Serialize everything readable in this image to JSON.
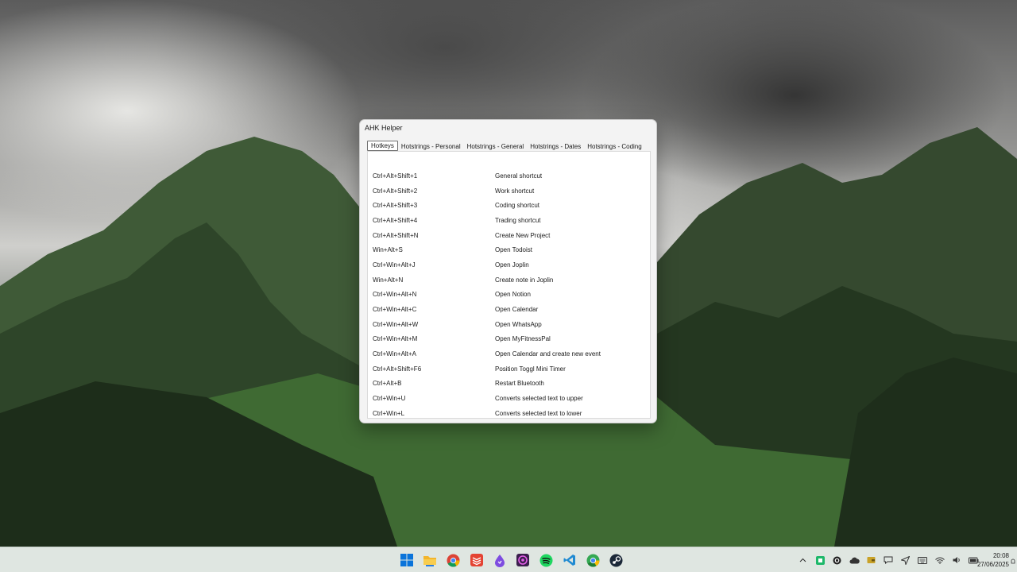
{
  "window": {
    "title": "AHK Helper"
  },
  "tabs": [
    {
      "label": "Hotkeys",
      "active": true
    },
    {
      "label": "Hotstrings - Personal",
      "active": false
    },
    {
      "label": "Hotstrings - General",
      "active": false
    },
    {
      "label": "Hotstrings - Dates",
      "active": false
    },
    {
      "label": "Hotstrings - Coding",
      "active": false
    }
  ],
  "hotkeys": [
    {
      "key": "Ctrl+Alt+Shift+1",
      "desc": "General shortcut"
    },
    {
      "key": "Ctrl+Alt+Shift+2",
      "desc": "Work shortcut"
    },
    {
      "key": "Ctrl+Alt+Shift+3",
      "desc": "Coding shortcut"
    },
    {
      "key": "Ctrl+Alt+Shift+4",
      "desc": "Trading shortcut"
    },
    {
      "key": "Ctrl+Alt+Shift+N",
      "desc": "Create New Project"
    },
    {
      "key": "Win+Alt+S",
      "desc": "Open Todoist"
    },
    {
      "key": "Ctrl+Win+Alt+J",
      "desc": "Open Joplin"
    },
    {
      "key": "Win+Alt+N",
      "desc": "Create note in Joplin"
    },
    {
      "key": "Ctrl+Win+Alt+N",
      "desc": "Open Notion"
    },
    {
      "key": "Ctrl+Win+Alt+C",
      "desc": "Open Calendar"
    },
    {
      "key": "Ctrl+Win+Alt+W",
      "desc": "Open WhatsApp"
    },
    {
      "key": "Ctrl+Win+Alt+M",
      "desc": "Open MyFitnessPal"
    },
    {
      "key": "Ctrl+Win+Alt+A",
      "desc": "Open Calendar and create new event"
    },
    {
      "key": "Ctrl+Alt+Shift+F6",
      "desc": "Position Toggl Mini Timer"
    },
    {
      "key": "Ctrl+Alt+B",
      "desc": "Restart Bluetooth"
    },
    {
      "key": "Ctrl+Win+U",
      "desc": "Converts selected text to upper"
    },
    {
      "key": "Ctrl+Win+L",
      "desc": "Converts selected text to lower"
    }
  ],
  "taskbar": {
    "apps": [
      "windows-start-icon",
      "file-explorer-icon",
      "chrome-icon",
      "todoist-icon",
      "joplin-icon",
      "podcast-icon",
      "spotify-icon",
      "vscode-icon",
      "chrome-canary-icon",
      "steam-icon"
    ],
    "tray": [
      "chevron-up-icon",
      "green-app-icon",
      "circle-app-icon",
      "cloud-icon",
      "wallet-icon",
      "chat-icon",
      "send-icon",
      "keyboard-icon",
      "wifi-icon",
      "volume-icon",
      "battery-icon"
    ],
    "time": "20:08",
    "date": "27/06/2025"
  },
  "colors": {
    "accent": "#0067c0",
    "window_bg": "#f3f3f3",
    "panel_bg": "#ffffff",
    "taskbar_bg": "#dfe6e1"
  }
}
